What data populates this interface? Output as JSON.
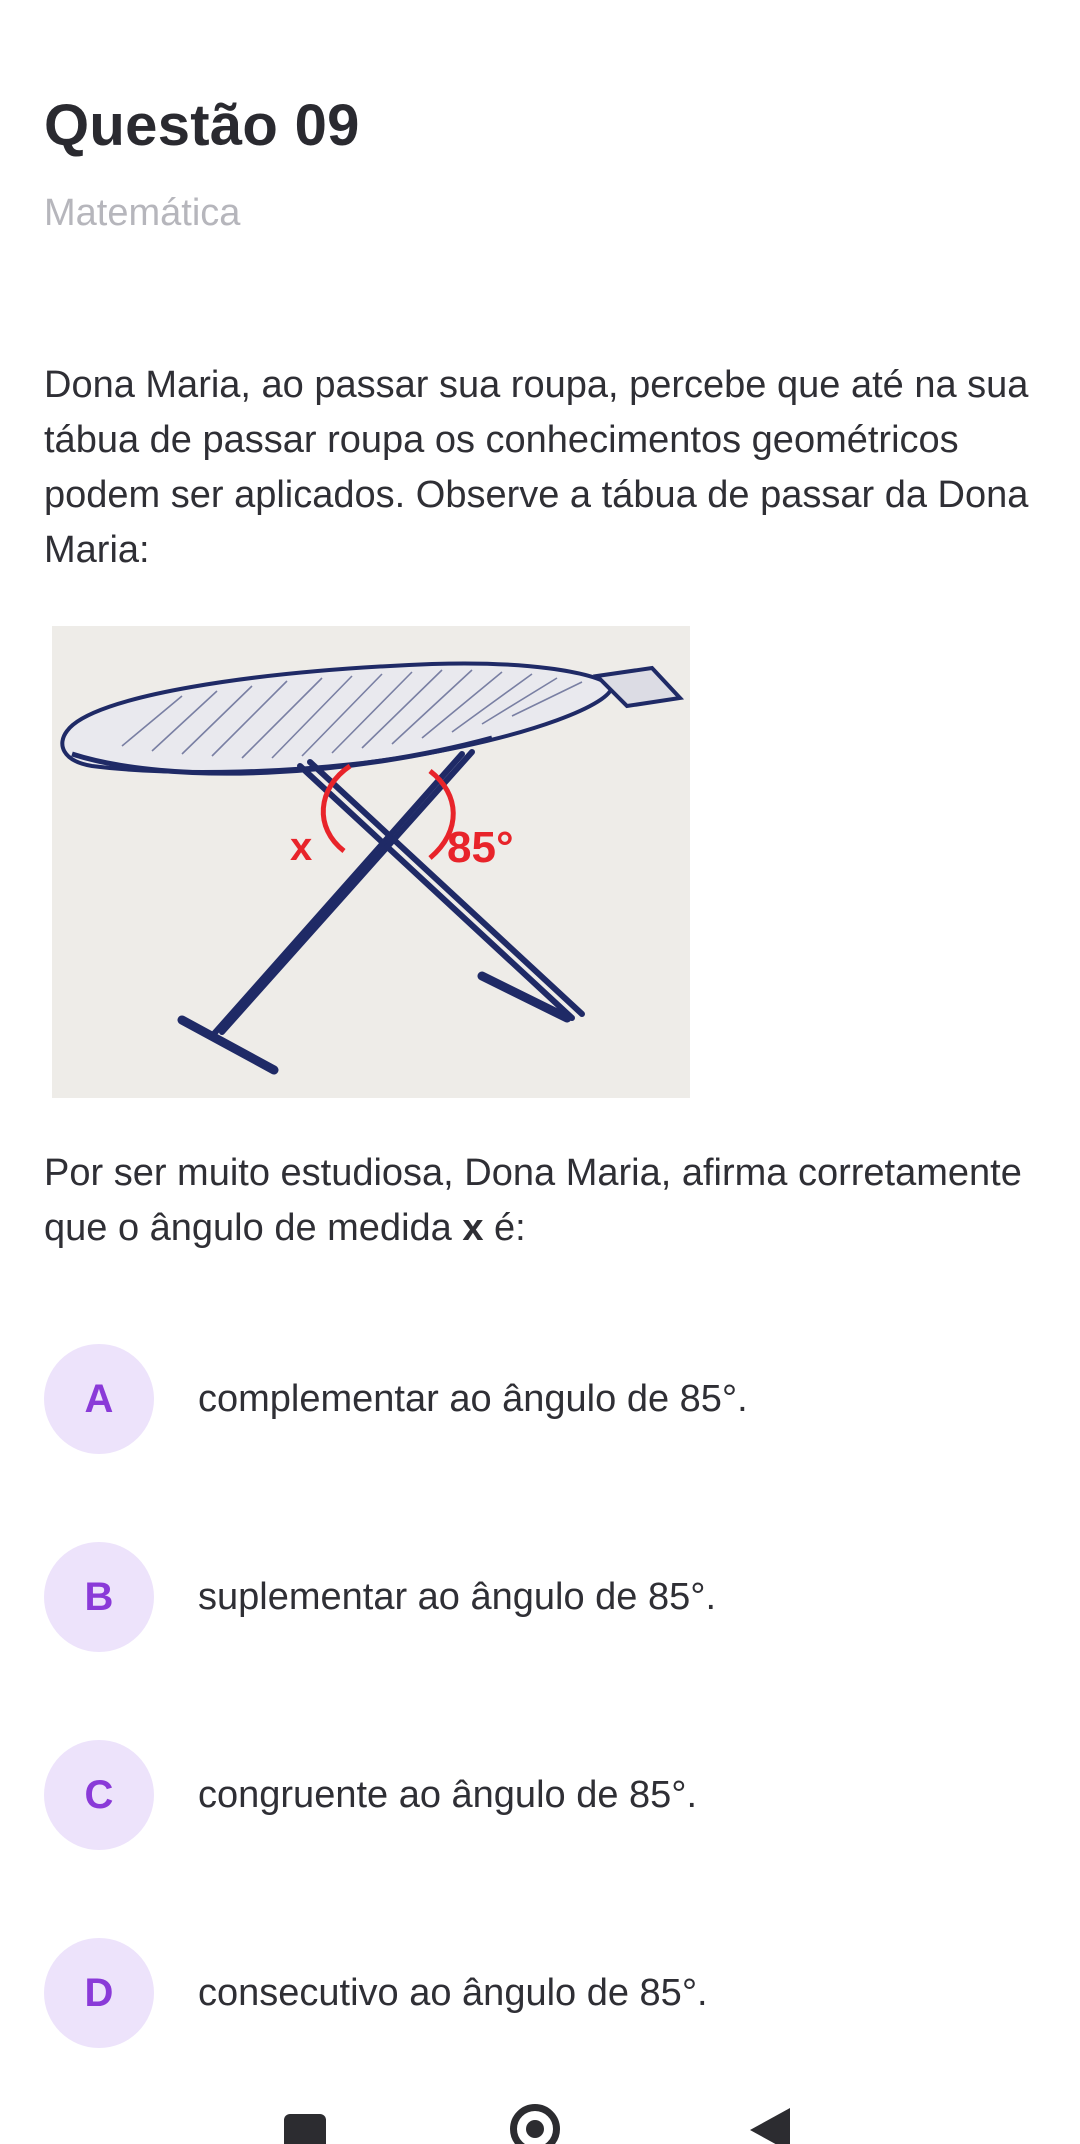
{
  "header": {
    "title": "Questão 09",
    "subject": "Matemática"
  },
  "question": {
    "statement": "Dona Maria, ao passar sua roupa, percebe que até na sua tábua de passar roupa os conhecimentos geométricos podem ser aplicados. Observe a tábua de passar da Dona Maria:",
    "prompt_before": "Por ser muito estudiosa, Dona Maria, afirma corretamente que o ângulo de medida ",
    "prompt_variable": "x",
    "prompt_after": " é:"
  },
  "figure": {
    "angle_label_x": "x",
    "angle_label_known": "85°",
    "line_color": "#1f2a66",
    "angle_color": "#e8242a"
  },
  "options": [
    {
      "letter": "A",
      "text": "complementar ao ângulo de 85°."
    },
    {
      "letter": "B",
      "text": "suplementar ao ângulo de 85°."
    },
    {
      "letter": "C",
      "text": "congruente ao ângulo de 85°."
    },
    {
      "letter": "D",
      "text": "consecutivo ao ângulo de 85°."
    }
  ],
  "colors": {
    "accent": "#8a3ad8",
    "accent_bg": "#ede3fb",
    "muted_text": "#b6b6bc"
  },
  "navbar": {
    "icons": [
      "recent-apps-icon",
      "home-icon",
      "back-icon"
    ]
  }
}
